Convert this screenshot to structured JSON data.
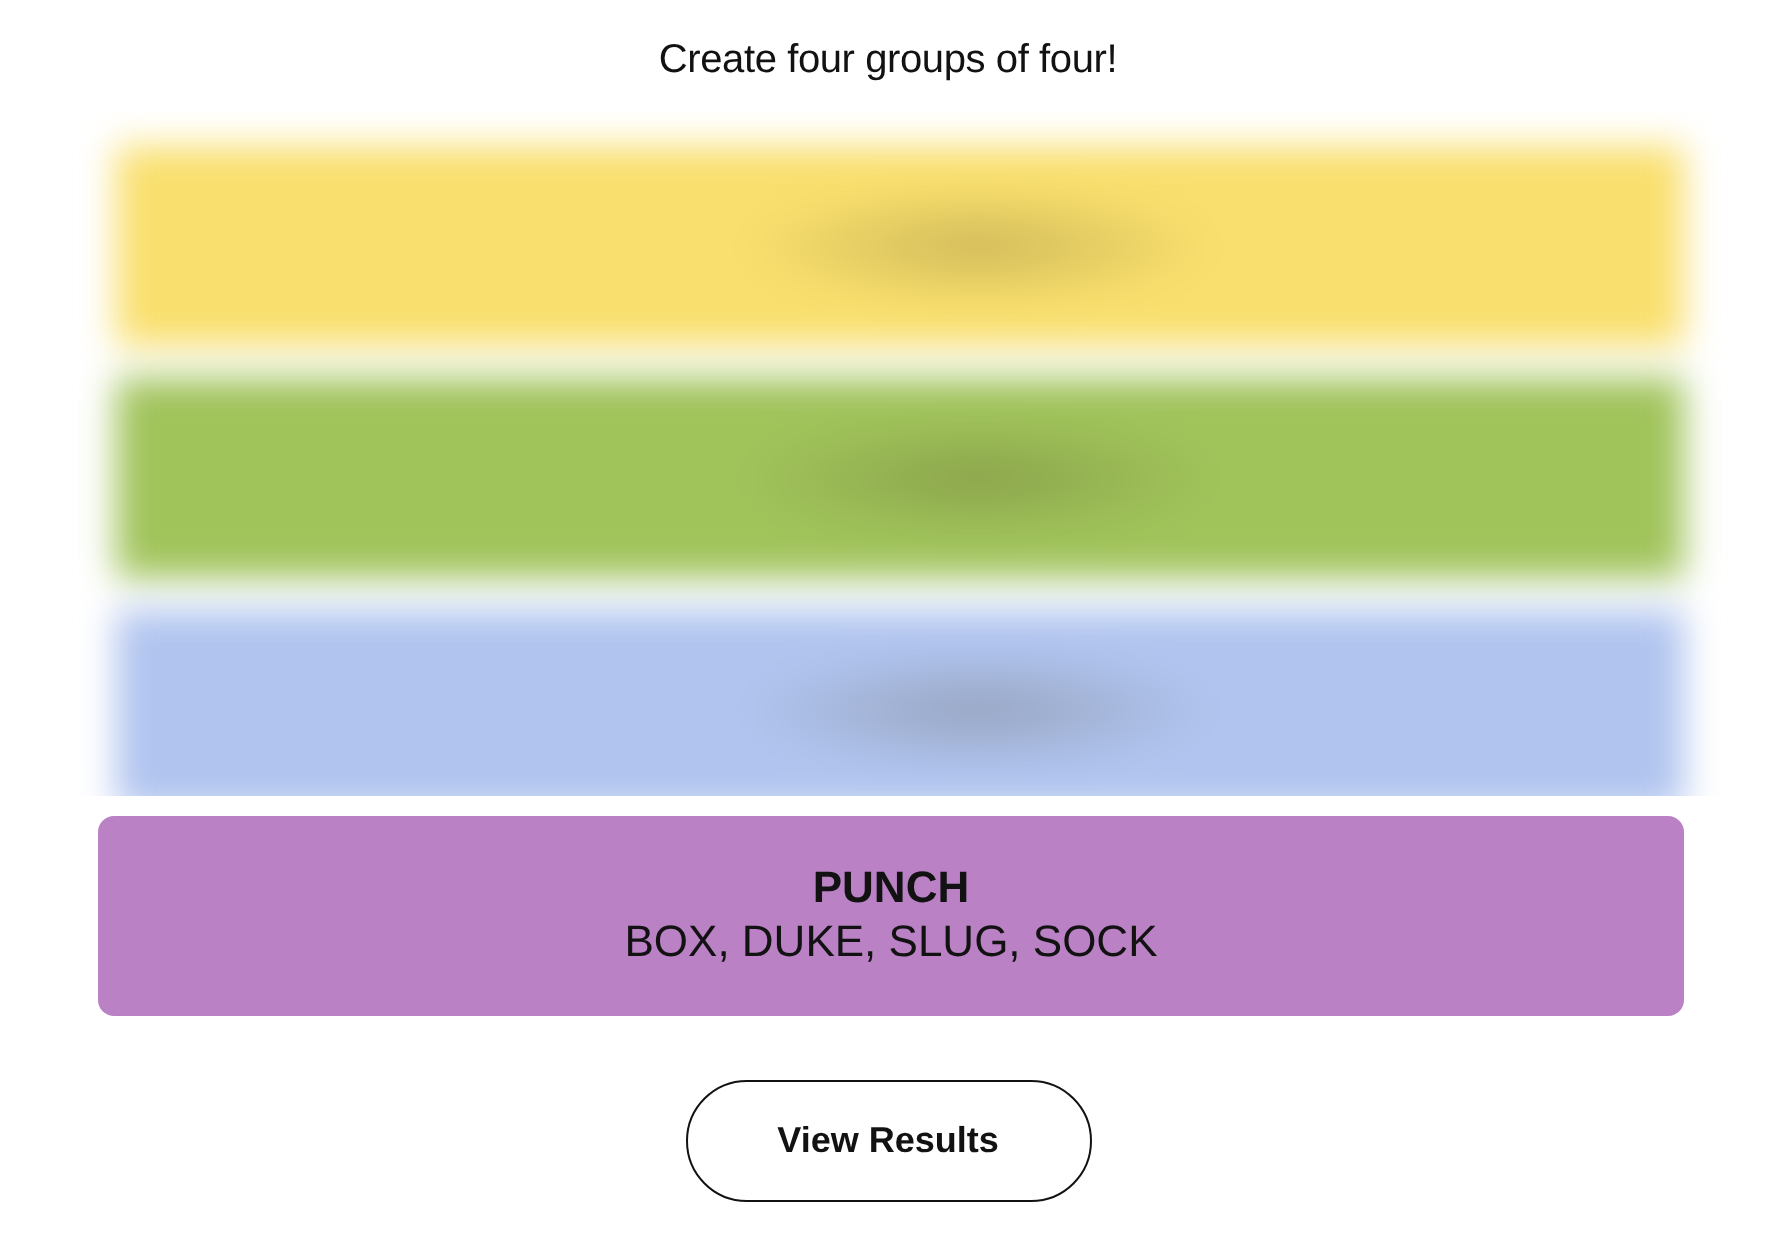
{
  "instruction": "Create four groups of four!",
  "hidden_groups": [
    {
      "color": "#f9df6d"
    },
    {
      "color": "#a0c35a"
    },
    {
      "color": "#b0c4ef"
    }
  ],
  "solved_groups": [
    {
      "title": "PUNCH",
      "members": "BOX, DUKE, SLUG, SOCK",
      "color": "#ba81c5"
    }
  ],
  "buttons": [
    {
      "label": "View Results"
    }
  ]
}
